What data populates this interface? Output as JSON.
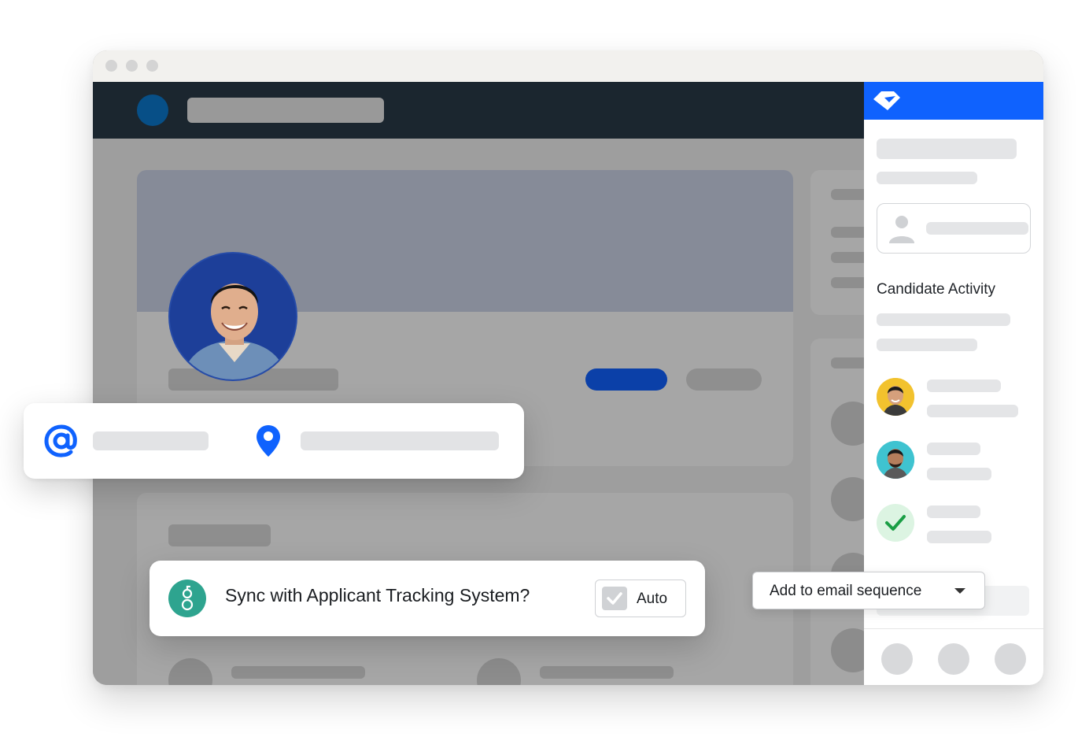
{
  "panel": {
    "section_title": "Candidate Activity"
  },
  "sync_prompt": {
    "question": "Sync with Applicant Tracking System?",
    "auto_label": "Auto",
    "auto_checked": true
  },
  "sequence_dropdown": {
    "label": "Add to email sequence"
  },
  "icons": {
    "email": "at-sign-icon",
    "location": "map-pin-icon",
    "ats": "greenhouse-logo-icon",
    "check": "checkmark-icon",
    "caret": "chevron-down-icon",
    "brand": "gem-logo-icon"
  },
  "colors": {
    "brand_blue": "#0f62fe",
    "app_header": "#1b262f",
    "primary_button": "#0b40a8",
    "ats_green": "#2ea48f",
    "success_green": "#1a9e45"
  }
}
